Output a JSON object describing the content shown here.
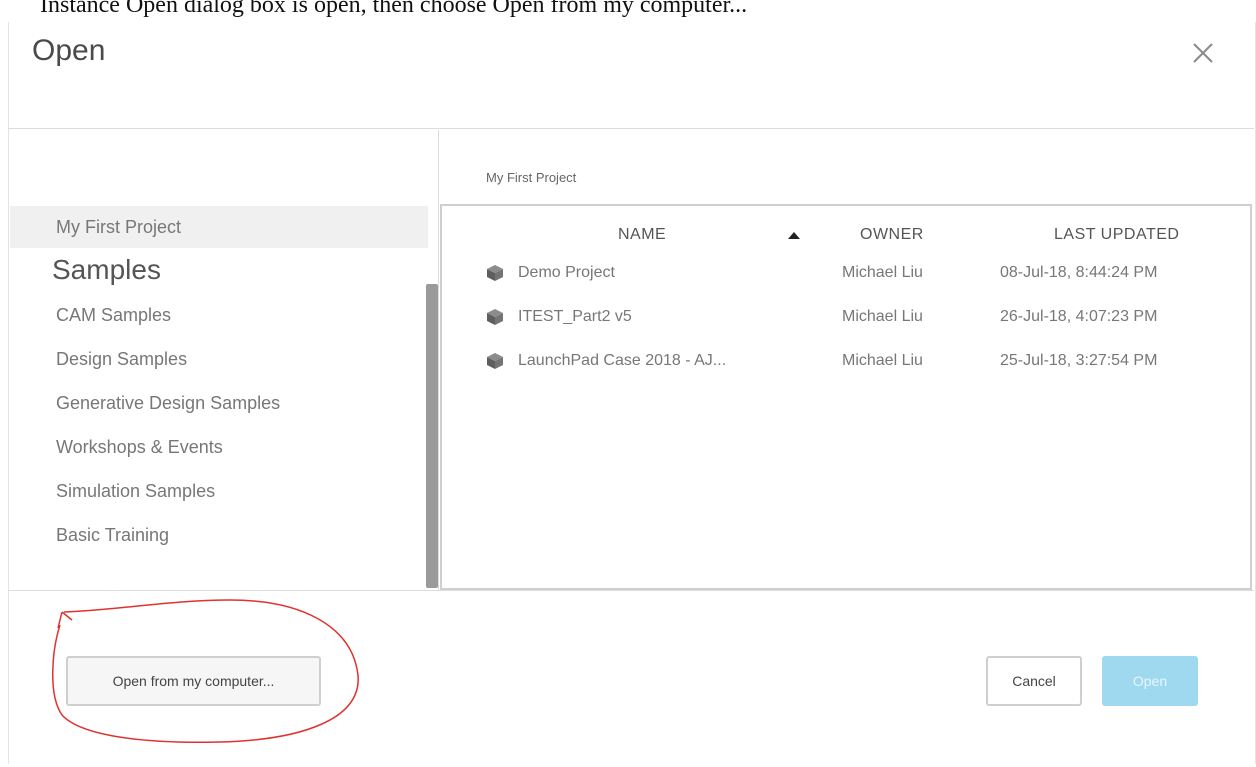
{
  "background_text": "Instance Open dialog box is open, then choose Open from my computer...",
  "dialog": {
    "title": "Open",
    "close_icon": "close-icon"
  },
  "sidebar": {
    "items": [
      {
        "label": "My First Project",
        "selected": true
      }
    ],
    "heading": "Samples",
    "sample_items": [
      {
        "label": "CAM Samples"
      },
      {
        "label": "Design Samples"
      },
      {
        "label": "Generative Design Samples"
      },
      {
        "label": "Workshops & Events"
      },
      {
        "label": "Simulation Samples"
      },
      {
        "label": "Basic Training"
      }
    ]
  },
  "main": {
    "breadcrumb": "My First Project",
    "columns": {
      "name": "NAME",
      "owner": "OWNER",
      "last_updated": "LAST UPDATED"
    },
    "sort_icon": "sort-ascending-icon",
    "files": [
      {
        "name": "Demo Project",
        "owner": "Michael Liu",
        "updated": "08-Jul-18, 8:44:24 PM",
        "icon": "cube-icon"
      },
      {
        "name": "ITEST_Part2 v5",
        "owner": "Michael Liu",
        "updated": "26-Jul-18, 4:07:23 PM",
        "icon": "cube-icon"
      },
      {
        "name": "LaunchPad Case 2018 - AJ...",
        "owner": "Michael Liu",
        "updated": "25-Jul-18, 3:27:54 PM",
        "icon": "cube-icon"
      }
    ]
  },
  "footer": {
    "open_from_computer_label": "Open from my computer...",
    "cancel_label": "Cancel",
    "open_label": "Open"
  },
  "colors": {
    "primary_disabled": "#9fd9ef",
    "annotation_red": "#e0322f"
  }
}
